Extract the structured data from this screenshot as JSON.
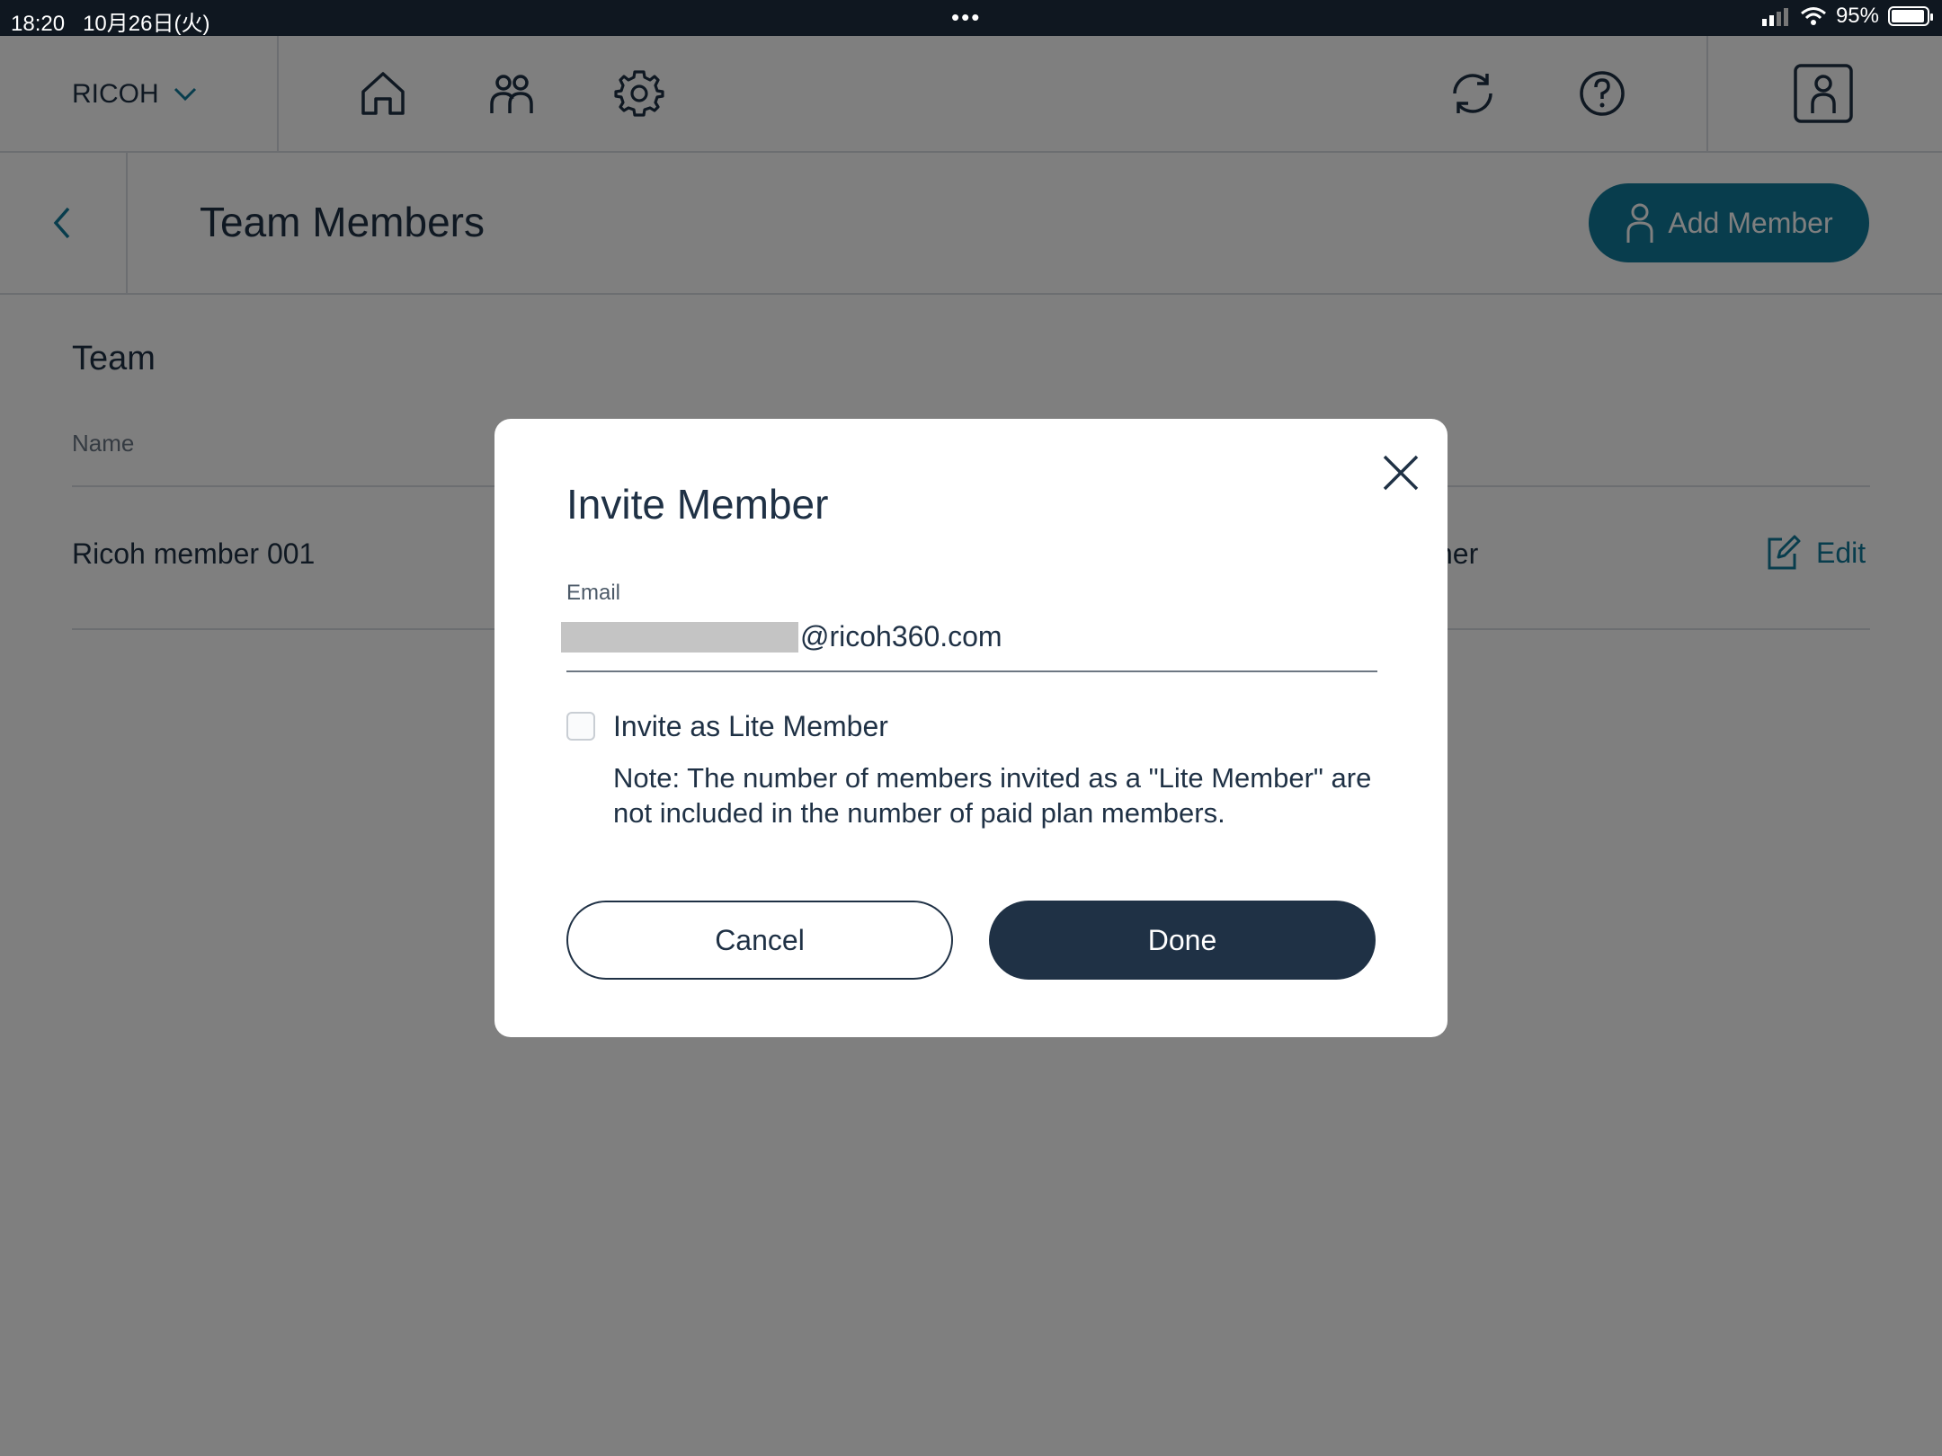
{
  "status_bar": {
    "time": "18:20",
    "date": "10月26日(火)",
    "dots": "•••",
    "battery": "95%"
  },
  "nav": {
    "brand": "RICOH"
  },
  "header": {
    "title": "Team Members",
    "add_member_label": "Add Member"
  },
  "team": {
    "heading": "Team",
    "column_name": "Name",
    "rows": [
      {
        "name": "Ricoh member 001",
        "role_visible": "ner",
        "edit_label": "Edit"
      }
    ]
  },
  "modal": {
    "title": "Invite Member",
    "email_label": "Email",
    "email_domain": "@ricoh360.com",
    "checkbox_label": "Invite as Lite Member",
    "checkbox_checked": false,
    "note": "Note: The number of members invited as a \"Lite Member\" are not included in the number of paid plan members.",
    "cancel_label": "Cancel",
    "done_label": "Done"
  },
  "colors": {
    "accent": "#117a9a",
    "primary_dark": "#1f3145"
  }
}
